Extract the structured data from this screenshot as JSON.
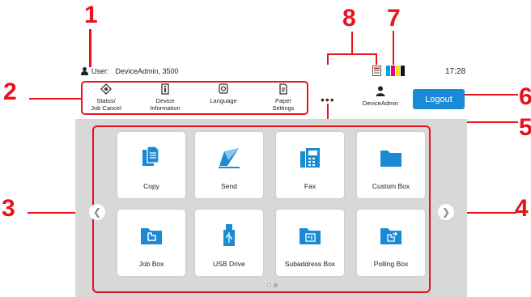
{
  "callouts": {
    "n1": "1",
    "n2": "2",
    "n3": "3",
    "n4": "4",
    "n5": "5",
    "n6": "6",
    "n7": "7",
    "n8": "8"
  },
  "header": {
    "user_label": "User:",
    "user_value": "DeviceAdmin, 3500",
    "clock": "17:28"
  },
  "tabs": [
    {
      "label": "Status/\nJob Cancel",
      "icon": "status-icon"
    },
    {
      "label": "Device\nInformation",
      "icon": "device-info-icon"
    },
    {
      "label": "Language",
      "icon": "language-icon"
    },
    {
      "label": "Paper\nSettings",
      "icon": "paper-settings-icon"
    }
  ],
  "account": {
    "name": "DeviceAdmin"
  },
  "logout_label": "Logout",
  "toner_colors": [
    "#00a0e9",
    "#e4007f",
    "#ffe100",
    "#111111"
  ],
  "accent_color": "#1a8ad4",
  "callout_color": "#e8121b",
  "tiles": [
    {
      "label": "Copy",
      "icon": "copy-icon"
    },
    {
      "label": "Send",
      "icon": "send-icon"
    },
    {
      "label": "Fax",
      "icon": "fax-icon"
    },
    {
      "label": "Custom Box",
      "icon": "custom-box-icon"
    },
    {
      "label": "Job Box",
      "icon": "job-box-icon"
    },
    {
      "label": "USB Drive",
      "icon": "usb-drive-icon"
    },
    {
      "label": "Subaddress Box",
      "icon": "subaddress-box-icon"
    },
    {
      "label": "Polling Box",
      "icon": "polling-box-icon"
    }
  ],
  "pagination": {
    "pages": 2,
    "current": 2
  }
}
